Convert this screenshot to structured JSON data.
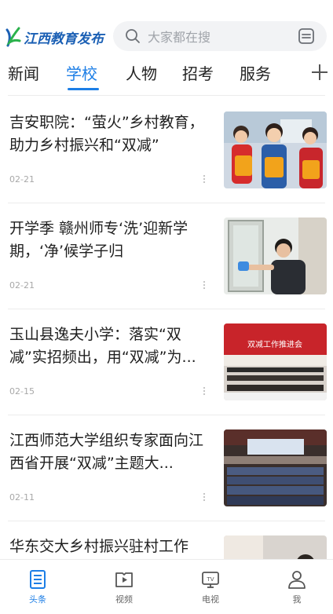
{
  "header": {
    "logo_text": "江西教育发布",
    "search_placeholder": "大家都在搜"
  },
  "tabs": [
    {
      "label": "新闻",
      "active": false
    },
    {
      "label": "学校",
      "active": true
    },
    {
      "label": "人物",
      "active": false
    },
    {
      "label": "招考",
      "active": false
    },
    {
      "label": "服务",
      "active": false
    },
    {
      "label": "",
      "active": false
    }
  ],
  "news": [
    {
      "title": "吉安职院：“萤火”乡村教育，助力乡村振兴和“双减”",
      "date": "02-21",
      "thumb": "children-tigers-photo"
    },
    {
      "title": "开学季 赣州师专‘洗’迎新学期，‘净’候学子归",
      "date": "02-21",
      "thumb": "window-cleaning-photo"
    },
    {
      "title": "玉山县逸夫小学：落实“双减”实招频出，用“双减”为...",
      "date": "02-15",
      "thumb": "conference-photo-1"
    },
    {
      "title": "江西师范大学组织专家面向江西省开展“双减”主题大...",
      "date": "02-11",
      "thumb": "conference-photo-2"
    },
    {
      "title": "华东交大乡村振兴驻村工作",
      "date": "",
      "thumb": "village-photo"
    }
  ],
  "conference_banner": "双减工作推进会",
  "bottom_nav": [
    {
      "label": "头条",
      "icon": "headline-icon",
      "active": true
    },
    {
      "label": "视频",
      "icon": "video-icon",
      "active": false
    },
    {
      "label": "电视",
      "icon": "tv-icon",
      "active": false
    },
    {
      "label": "我",
      "icon": "me-icon",
      "active": false
    }
  ],
  "colors": {
    "accent": "#1c7ee6",
    "logo": "#1a5fb4",
    "logo_mark_green": "#2bb24c"
  }
}
